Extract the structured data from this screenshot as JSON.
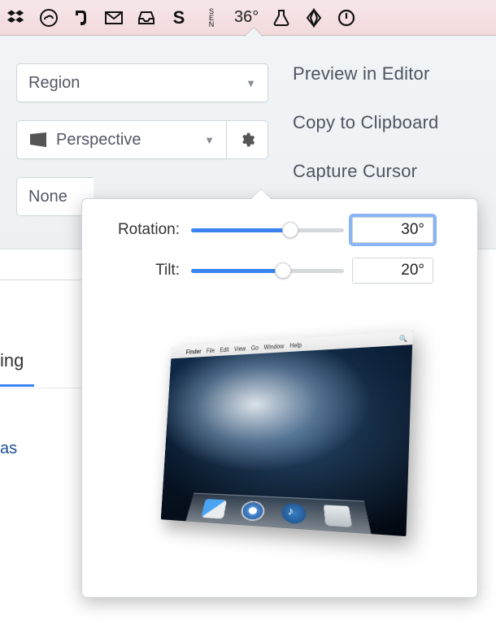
{
  "menubar": {
    "temperature": "36°",
    "icons": [
      "dropbox",
      "creative-cloud",
      "evernote",
      "gmail",
      "inbox",
      "skitch",
      "sensei",
      "temp",
      "beaker",
      "diamond",
      "power"
    ]
  },
  "panel": {
    "region_label": "Region",
    "effect_label": "Perspective",
    "none_label": "None"
  },
  "sidecol": {
    "preview": "Preview in Editor",
    "copy": "Copy to Clipboard",
    "cursor": "Capture Cursor"
  },
  "popover": {
    "rotation_label": "Rotation:",
    "rotation_value": "30°",
    "rotation_fill_pct": 65,
    "tilt_label": "Tilt:",
    "tilt_value": "20°",
    "tilt_fill_pct": 60,
    "desk_menus": [
      "",
      "Finder",
      "File",
      "Edit",
      "View",
      "Go",
      "Window",
      "Help"
    ]
  },
  "left": {
    "tab": "ing",
    "link": "as"
  }
}
